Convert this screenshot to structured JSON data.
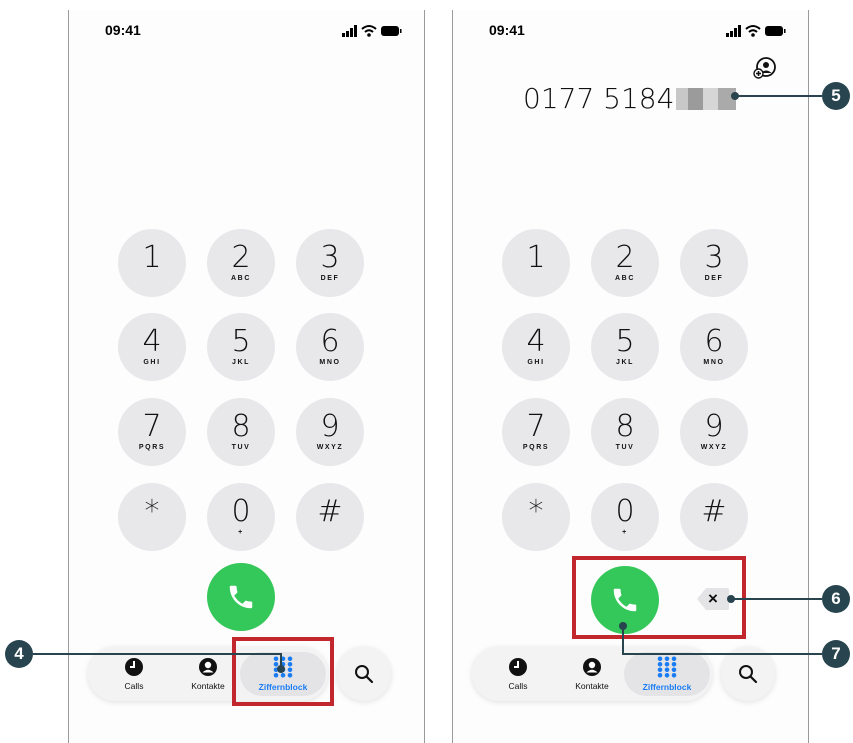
{
  "status_bar": {
    "time": "09:41"
  },
  "keypad": [
    {
      "digit": "1",
      "letters": ""
    },
    {
      "digit": "2",
      "letters": "ABC"
    },
    {
      "digit": "3",
      "letters": "DEF"
    },
    {
      "digit": "4",
      "letters": "GHI"
    },
    {
      "digit": "5",
      "letters": "JKL"
    },
    {
      "digit": "6",
      "letters": "MNO"
    },
    {
      "digit": "7",
      "letters": "PQRS"
    },
    {
      "digit": "8",
      "letters": "TUV"
    },
    {
      "digit": "9",
      "letters": "WXYZ"
    },
    {
      "digit": "*",
      "letters": ""
    },
    {
      "digit": "0",
      "letters": "+"
    },
    {
      "digit": "#",
      "letters": ""
    }
  ],
  "tabs": [
    {
      "label": "Calls",
      "icon": "clock-icon",
      "active": false
    },
    {
      "label": "Kontakte",
      "icon": "person-icon",
      "active": false
    },
    {
      "label": "Ziffernblock",
      "icon": "keypad-grid-icon",
      "active": true
    }
  ],
  "dialed_number": "0177 5184",
  "delete_symbol": "×",
  "callouts": {
    "left": "4",
    "number": "5",
    "delete": "6",
    "call": "7"
  },
  "colors": {
    "call_green": "#34c759",
    "active_blue": "#1a7cf5",
    "highlight_red": "#c1272d",
    "marker": "#28444f",
    "key_grey": "#e8e7ea"
  }
}
